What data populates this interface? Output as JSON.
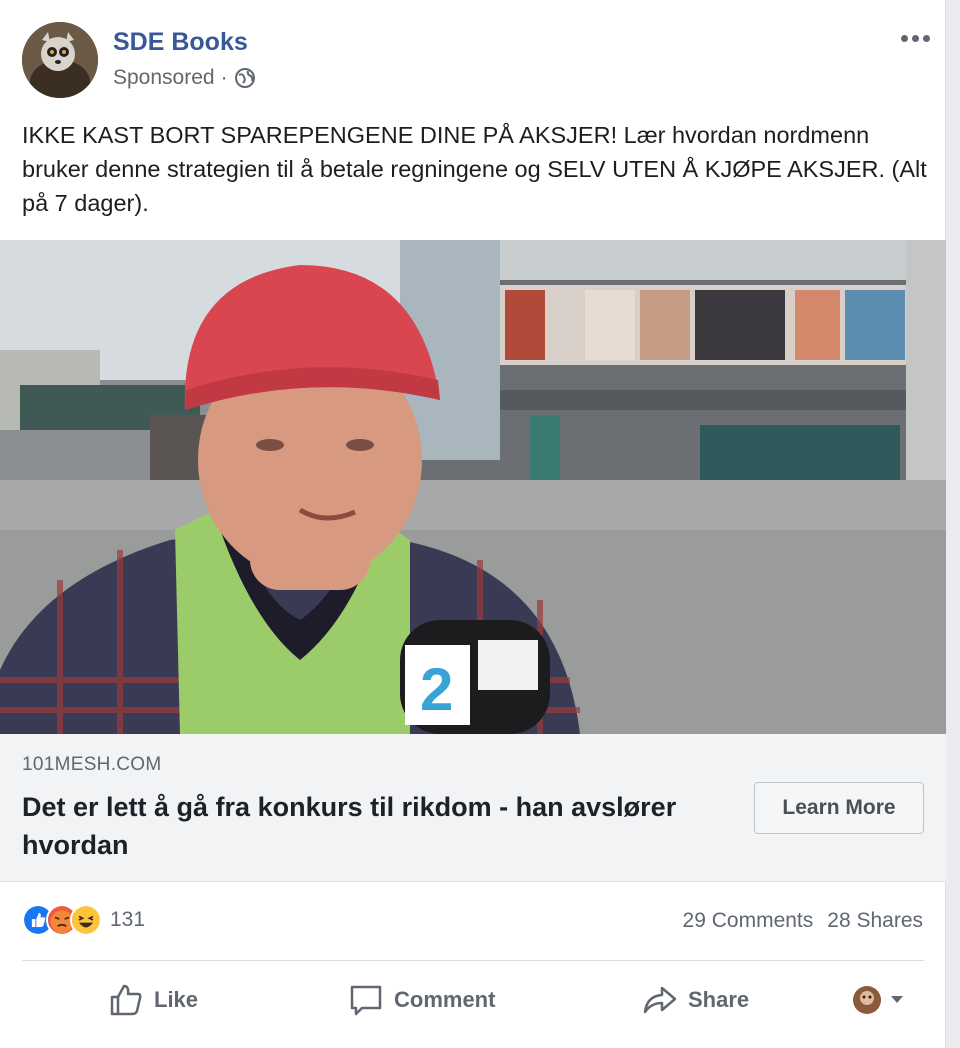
{
  "post": {
    "page_name": "SDE Books",
    "sponsored_label": "Sponsored",
    "separator": "·",
    "text": "IKKE KAST BORT SPAREPENGENE DINE PÅ AKSJER! Lær hvordan nordmenn bruker denne strategien til å betale regningene og SELV UTEN Å KJØPE AKSJER. (Alt på 7 dager)."
  },
  "link_preview": {
    "domain": "101MESH.COM",
    "headline": "Det er lett å gå fra konkurs til rikdom - han avslører hvordan",
    "cta_label": "Learn More"
  },
  "engagement": {
    "reaction_icons": [
      "like-reaction",
      "angry-reaction",
      "haha-reaction"
    ],
    "reaction_count": "131",
    "comments": "29 Comments",
    "shares": "28 Shares"
  },
  "actions": {
    "like": "Like",
    "comment": "Comment",
    "share": "Share"
  },
  "colors": {
    "link_blue": "#385898",
    "secondary_text": "#606770",
    "like_blue": "#1877f2",
    "reaction_yellow": "#fcc43c",
    "angry_orange": "#f0593a"
  }
}
